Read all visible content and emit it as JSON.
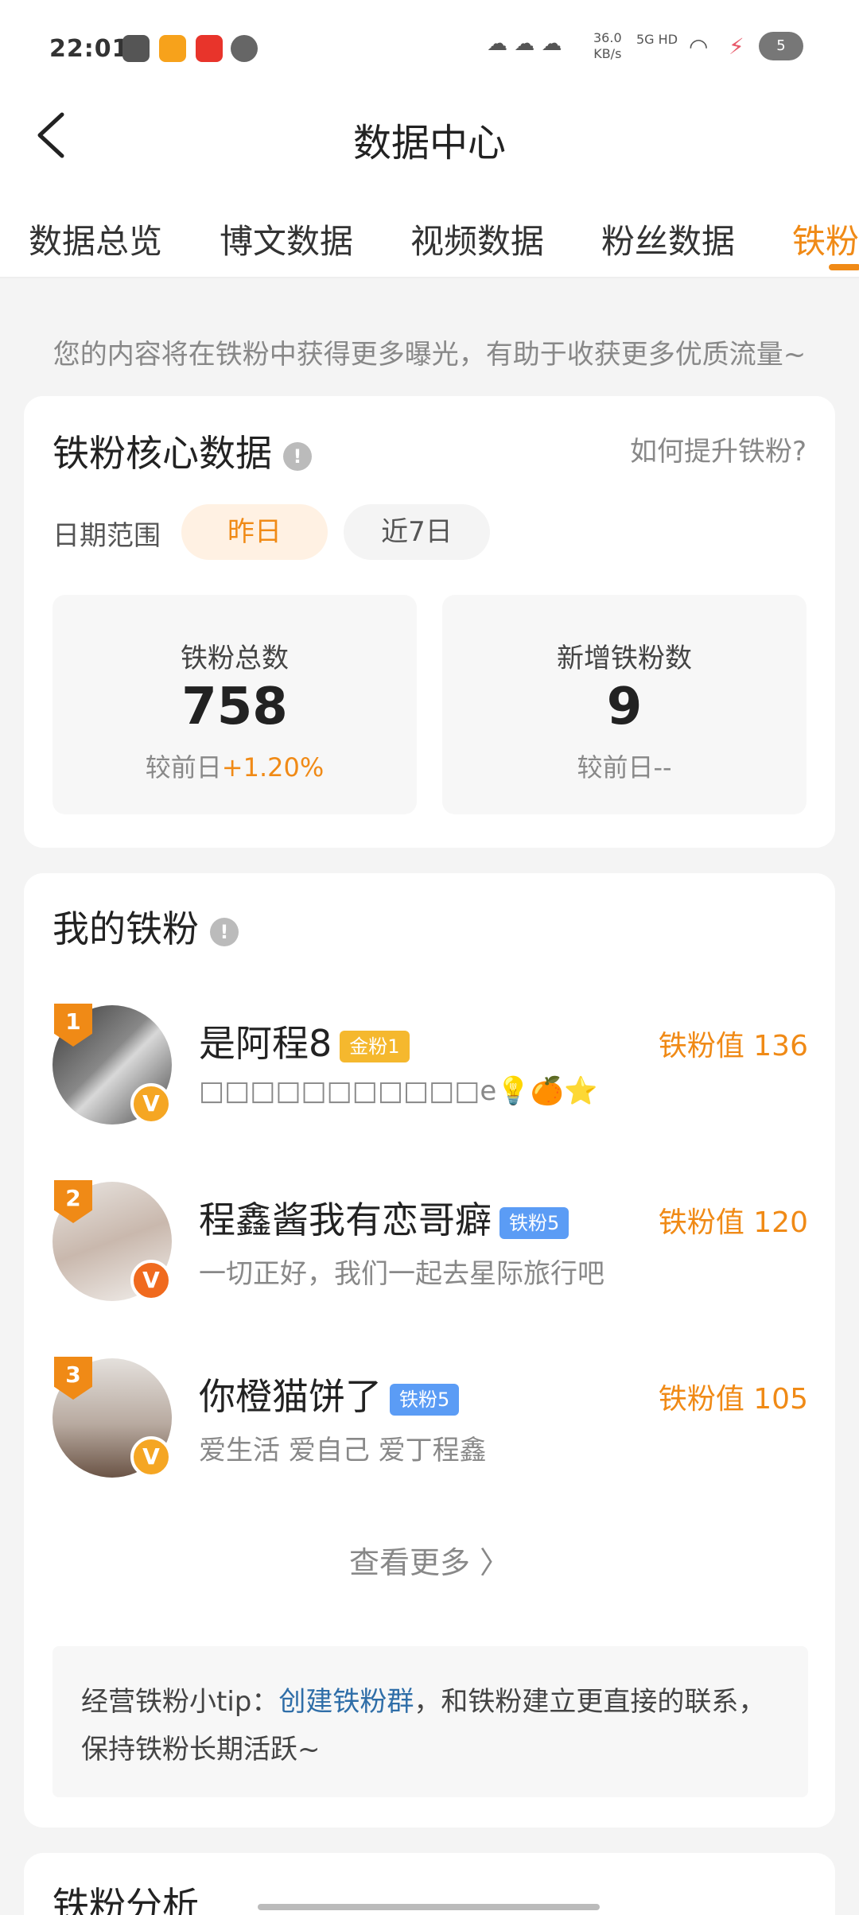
{
  "status_bar": {
    "time": "22:01",
    "network_speed": "36.0",
    "network_unit": "KB/s",
    "signal": "5G HD",
    "battery": "5"
  },
  "header": {
    "title": "数据中心",
    "tabs": [
      {
        "label": "数据总览"
      },
      {
        "label": "博文数据"
      },
      {
        "label": "视频数据"
      },
      {
        "label": "粉丝数据"
      },
      {
        "label": "铁粉"
      }
    ]
  },
  "notice": "您的内容将在铁粉中获得更多曝光，有助于收获更多优质流量~",
  "core_card": {
    "title": "铁粉核心数据",
    "help_link": "如何提升铁粉?",
    "date_label": "日期范围",
    "date_options": [
      "昨日",
      "近7日"
    ],
    "stats": [
      {
        "label": "铁粉总数",
        "value": "758",
        "compare_prefix": "较前日",
        "compare_value": "+1.20%"
      },
      {
        "label": "新增铁粉数",
        "value": "9",
        "compare_prefix": "较前日",
        "compare_value": "--"
      }
    ]
  },
  "fans_card": {
    "title": "我的铁粉",
    "fans": [
      {
        "rank": "1",
        "name": "是阿程8",
        "tag": "金粉1",
        "bio": "□□□□□□□□□□□e💡🍊⭐",
        "score": "铁粉值 136"
      },
      {
        "rank": "2",
        "name": "程鑫酱我有恋哥癖",
        "tag": "铁粉5",
        "bio": "一切正好，我们一起去星际旅行吧",
        "score": "铁粉值 120"
      },
      {
        "rank": "3",
        "name": "你橙猫饼了",
        "tag": "铁粉5",
        "bio": "爱生活 爱自己 爱丁程鑫",
        "score": "铁粉值 105"
      }
    ],
    "see_more": "查看更多 〉",
    "tip_prefix": "经营铁粉小tip：",
    "tip_link": "创建铁粉群",
    "tip_suffix": "，和铁粉建立更直接的联系，保持铁粉长期活跃~"
  },
  "bottom_card": {
    "title": "铁粉分析"
  },
  "colors": {
    "accent": "#f08a16",
    "link": "#2f6ea8"
  }
}
